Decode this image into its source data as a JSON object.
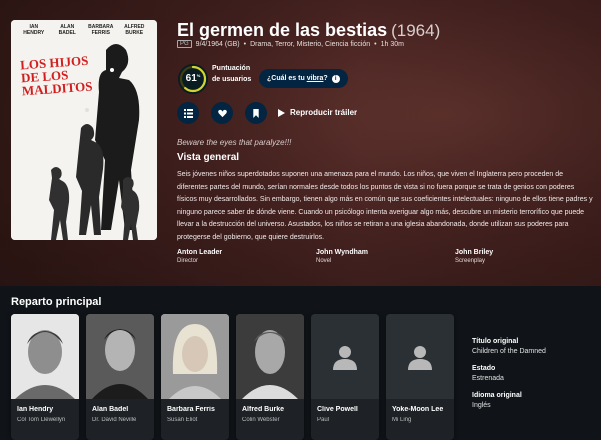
{
  "movie": {
    "title": "El germen de las bestias",
    "year": "(1964)",
    "certification": "PG",
    "release": "9/4/1964 (GB)",
    "genres": "Drama, Terror, Misterio, Ciencia ficción",
    "runtime": "1h 30m",
    "tagline": "Beware the eyes that paralyze!!!",
    "overview_heading": "Vista general",
    "overview": "Seis jóvenes niños superdotados suponen una amenaza para el mundo. Los niños, que viven el Inglaterra pero proceden de diferentes partes del mundo, serían normales desde todos los puntos de vista si no fuera porque se trata de genios con poderes físicos muy desarrollados. Sin embargo, tienen algo más en común que sus coeficientes intelectuales: ninguno de ellos tiene padres y ninguno parece saber de dónde viene. Cuando un psicólogo intenta averiguar algo más, descubre un misterio terrorífico que puede llevar a la destrucción del universo. Asustados, los niños se retiran a una iglesia abandonada, donde utilizan sus poderes para protegerse del gobierno, que quiere destruirlos."
  },
  "poster": {
    "credits": [
      "IAN HENDRY",
      "ALAN BADEL",
      "BARBARA FERRIS",
      "ALFRED BURKE"
    ],
    "title": "LOS HIJOS DE LOS MALDITOS"
  },
  "score": {
    "value": "61",
    "percent_sign": "%",
    "fraction": 0.61,
    "label": "Puntuación de usuarios",
    "ring_color": "#d2d531"
  },
  "vibe": {
    "prefix": "¿Cuál es tu ",
    "link": "vibra",
    "suffix": "?"
  },
  "actions": {
    "list_icon": "list-icon",
    "favorite_icon": "heart-icon",
    "watchlist_icon": "bookmark-icon",
    "trailer_label": "Reproducir tráiler"
  },
  "crew": [
    {
      "name": "Anton Leader",
      "role": "Director"
    },
    {
      "name": "John Wyndham",
      "role": "Novel"
    },
    {
      "name": "John Briley",
      "role": "Screenplay"
    }
  ],
  "cast_heading": "Reparto principal",
  "cast": [
    {
      "name": "Ian Hendry",
      "character": "Col Tom Llewellyn"
    },
    {
      "name": "Alan Badel",
      "character": "Dr. David Neville"
    },
    {
      "name": "Barbara Ferris",
      "character": "Susan Eliot"
    },
    {
      "name": "Alfred Burke",
      "character": "Colin Webster"
    },
    {
      "name": "Clive Powell",
      "character": "Paul"
    },
    {
      "name": "Yoke-Moon Lee",
      "character": "Mi Ling"
    }
  ],
  "facts": [
    {
      "label": "Título original",
      "value": "Children of the Damned"
    },
    {
      "label": "Estado",
      "value": "Estrenada"
    },
    {
      "label": "Idioma original",
      "value": "Inglés"
    }
  ],
  "colors": {
    "hero_bg": "#4a2523",
    "accent": "#032541",
    "score_ring": "#d2d531"
  }
}
